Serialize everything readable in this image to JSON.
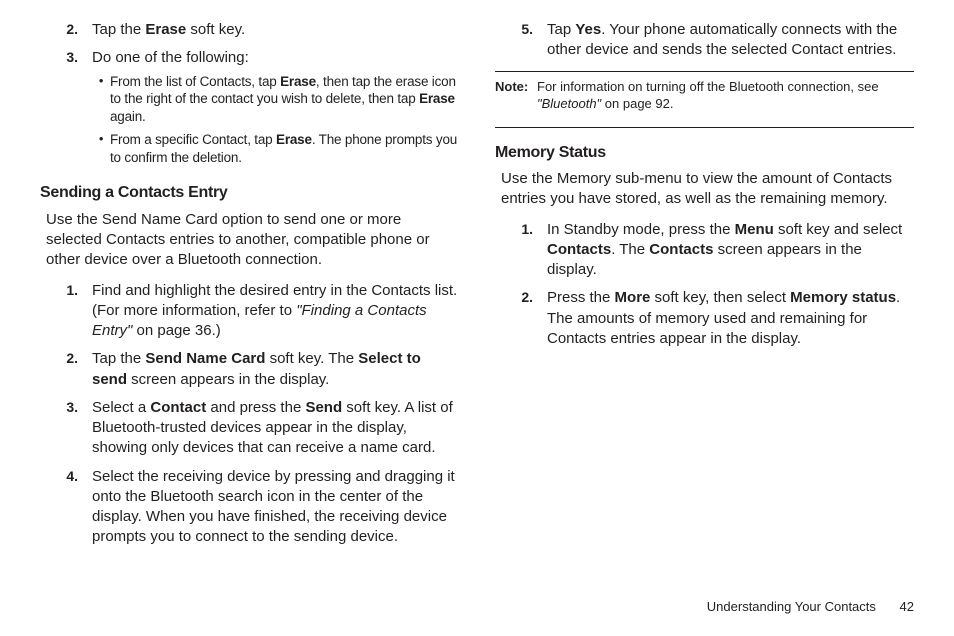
{
  "left": {
    "topSteps": [
      {
        "n": "2.",
        "parts": [
          {
            "t": "Tap the "
          },
          {
            "t": "Erase",
            "b": true
          },
          {
            "t": " soft key."
          }
        ]
      },
      {
        "n": "3.",
        "parts": [
          {
            "t": "Do one of the following:"
          }
        ],
        "bullets": [
          [
            {
              "t": "From the list of Contacts, tap "
            },
            {
              "t": "Erase",
              "b": true
            },
            {
              "t": ", then tap the erase icon to the right of the contact you wish to delete, then tap "
            },
            {
              "t": "Erase",
              "b": true
            },
            {
              "t": " again."
            }
          ],
          [
            {
              "t": "From a specific Contact, tap "
            },
            {
              "t": "Erase",
              "b": true
            },
            {
              "t": ". The phone prompts you to confirm the deletion."
            }
          ]
        ]
      }
    ],
    "heading1": "Sending a Contacts Entry",
    "intro1": "Use the Send Name Card option to send one or more selected Contacts entries to another, compatible phone or other device over a Bluetooth connection.",
    "sendSteps": [
      {
        "n": "1.",
        "parts": [
          {
            "t": "Find and highlight the desired entry in the Contacts list. (For more information, refer to "
          },
          {
            "t": "\"Finding a Contacts Entry\"",
            "i": true
          },
          {
            "t": " on page 36.)"
          }
        ]
      },
      {
        "n": "2.",
        "parts": [
          {
            "t": "Tap the "
          },
          {
            "t": "Send Name Card",
            "b": true
          },
          {
            "t": " soft key. The "
          },
          {
            "t": "Select to send",
            "b": true
          },
          {
            "t": " screen appears in the display."
          }
        ]
      },
      {
        "n": "3.",
        "parts": [
          {
            "t": "Select a "
          },
          {
            "t": "Contact",
            "b": true
          },
          {
            "t": " and press the "
          },
          {
            "t": "Send",
            "b": true
          },
          {
            "t": " soft key. A list of Bluetooth-trusted devices appear in the display, showing only devices that can receive a name card."
          }
        ]
      },
      {
        "n": "4.",
        "parts": [
          {
            "t": "Select the receiving device by pressing and dragging it onto the Bluetooth search icon in the center of the display. When you have finished, the receiving device prompts you to connect to the sending device."
          }
        ]
      }
    ]
  },
  "right": {
    "contStep": {
      "n": "5.",
      "parts": [
        {
          "t": "Tap "
        },
        {
          "t": "Yes",
          "b": true
        },
        {
          "t": ". Your phone automatically connects with the other device and sends the selected Contact entries."
        }
      ]
    },
    "noteLabel": "Note:",
    "noteBody": [
      {
        "t": "For information on turning off the Bluetooth connection, see "
      },
      {
        "t": "\"Bluetooth\"",
        "i": true
      },
      {
        "t": " on page 92."
      }
    ],
    "heading2": "Memory Status",
    "intro2": "Use the Memory sub-menu to view the amount of Contacts entries you have stored, as well as the remaining memory.",
    "memSteps": [
      {
        "n": "1.",
        "parts": [
          {
            "t": "In Standby mode, press the "
          },
          {
            "t": "Menu",
            "b": true
          },
          {
            "t": " soft key and select "
          },
          {
            "t": "Contacts",
            "b": true
          },
          {
            "t": ". The "
          },
          {
            "t": "Contacts",
            "b": true
          },
          {
            "t": " screen appears in the display."
          }
        ]
      },
      {
        "n": "2.",
        "parts": [
          {
            "t": "Press the "
          },
          {
            "t": "More",
            "b": true
          },
          {
            "t": " soft key, then select "
          },
          {
            "t": "Memory status",
            "b": true
          },
          {
            "t": ". The amounts of memory used and remaining for Contacts entries appear in the display."
          }
        ]
      }
    ]
  },
  "footer": {
    "title": "Understanding Your Contacts",
    "page": "42"
  }
}
